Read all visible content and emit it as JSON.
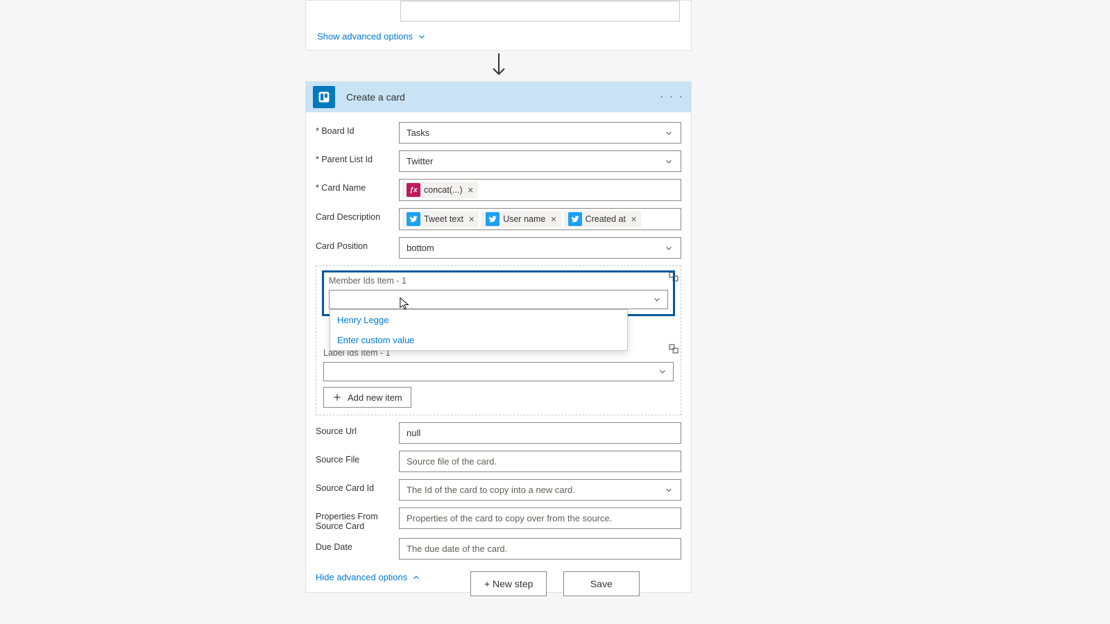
{
  "topCard": {
    "showAdvanced": "Show advanced options"
  },
  "mainCard": {
    "title": "Create a card",
    "menu": "· · ·",
    "fields": {
      "boardId": {
        "label": "Board Id",
        "value": "Tasks"
      },
      "parentListId": {
        "label": "Parent List Id",
        "value": "Twitter"
      },
      "cardName": {
        "label": "Card Name",
        "tokens": [
          {
            "kind": "fx",
            "text": "concat(...)"
          }
        ]
      },
      "cardDescription": {
        "label": "Card Description",
        "tokens": [
          {
            "kind": "tw",
            "text": "Tweet text"
          },
          {
            "kind": "tw",
            "text": "User name"
          },
          {
            "kind": "tw",
            "text": "Created at"
          }
        ]
      },
      "cardPosition": {
        "label": "Card Position",
        "value": "bottom"
      },
      "memberIds": {
        "label": "Member Ids Item - 1",
        "option": "Henry Legge",
        "customValue": "Enter custom value"
      },
      "labelIds": {
        "label": "Label Ids Item - 1"
      },
      "addNewItem": "Add new item",
      "sourceUrl": {
        "label": "Source Url",
        "value": "null"
      },
      "sourceFile": {
        "label": "Source File",
        "placeholder": "Source file of the card."
      },
      "sourceCardId": {
        "label": "Source Card Id",
        "placeholder": "The Id of the card to copy into a new card."
      },
      "propsFromSource": {
        "label": "Properties From Source Card",
        "placeholder": "Properties of the card to copy over from the source."
      },
      "dueDate": {
        "label": "Due Date",
        "placeholder": "The due date of the card."
      },
      "hideAdvanced": "Hide advanced options"
    }
  },
  "footer": {
    "newStep": "+ New step",
    "save": "Save"
  }
}
